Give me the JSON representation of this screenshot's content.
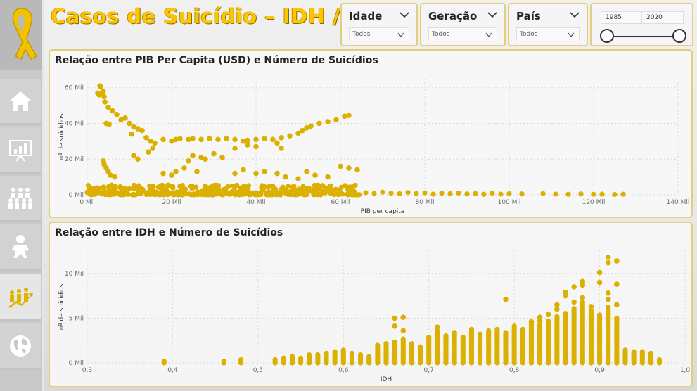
{
  "header": {
    "title": "Casos de Suicídio – IDH / PIB"
  },
  "nav": {
    "items": [
      {
        "icon": "home-icon",
        "active": false
      },
      {
        "icon": "presentation-chart-icon",
        "active": false
      },
      {
        "icon": "population-icon",
        "active": false
      },
      {
        "icon": "baby-icon",
        "active": false
      },
      {
        "icon": "growth-people-icon",
        "active": true
      },
      {
        "icon": "globe-icon",
        "active": false
      }
    ]
  },
  "filters": {
    "idade": {
      "label": "Idade",
      "value": "Todos"
    },
    "geracao": {
      "label": "Geração",
      "value": "Todos"
    },
    "pais": {
      "label": "País",
      "value": "Todos"
    },
    "ano": {
      "start": "1985",
      "end": "2020"
    }
  },
  "colors": {
    "accent": "#e0b400",
    "marker": "#dbb000"
  },
  "chart_data": [
    {
      "type": "scatter",
      "title": "Relação entre PIB Per Capita (USD) e Número de Suicídios",
      "xlabel": "PIB per capita",
      "ylabel": "nº de suicídios",
      "xlim": [
        0,
        140000
      ],
      "ylim": [
        0,
        65000
      ],
      "xticks": [
        {
          "v": 0,
          "label": "0 Mil"
        },
        {
          "v": 20000,
          "label": "20 Mil"
        },
        {
          "v": 40000,
          "label": "40 Mil"
        },
        {
          "v": 60000,
          "label": "60 Mil"
        },
        {
          "v": 80000,
          "label": "80 Mil"
        },
        {
          "v": 100000,
          "label": "100 Mil"
        },
        {
          "v": 120000,
          "label": "120 Mil"
        },
        {
          "v": 140000,
          "label": "140 Mil"
        }
      ],
      "yticks": [
        {
          "v": 0,
          "label": "0 Mil"
        },
        {
          "v": 20000,
          "label": "20 Mil"
        },
        {
          "v": 40000,
          "label": "40 Mil"
        },
        {
          "v": 60000,
          "label": "60 Mil"
        }
      ],
      "points": [
        [
          2500,
          57000
        ],
        [
          3000,
          61000
        ],
        [
          3200,
          60500
        ],
        [
          2800,
          56000
        ],
        [
          3500,
          57000
        ],
        [
          4000,
          55000
        ],
        [
          4200,
          52000
        ],
        [
          3800,
          58000
        ],
        [
          5000,
          49000
        ],
        [
          6000,
          47000
        ],
        [
          4500,
          40000
        ],
        [
          5200,
          39500
        ],
        [
          7000,
          45000
        ],
        [
          8000,
          42000
        ],
        [
          9000,
          43000
        ],
        [
          10000,
          40000
        ],
        [
          11000,
          38000
        ],
        [
          12000,
          37000
        ],
        [
          13000,
          36000
        ],
        [
          10500,
          34000
        ],
        [
          14000,
          32000
        ],
        [
          15000,
          30000
        ],
        [
          16000,
          29000
        ],
        [
          15500,
          26000
        ],
        [
          14500,
          24000
        ],
        [
          18000,
          31000
        ],
        [
          20000,
          30000
        ],
        [
          21000,
          31000
        ],
        [
          22000,
          31500
        ],
        [
          24000,
          31000
        ],
        [
          25000,
          31500
        ],
        [
          27000,
          31000
        ],
        [
          29000,
          31500
        ],
        [
          31000,
          31000
        ],
        [
          33000,
          31500
        ],
        [
          35000,
          31000
        ],
        [
          37000,
          30000
        ],
        [
          38000,
          30500
        ],
        [
          40000,
          31000
        ],
        [
          42000,
          31500
        ],
        [
          44000,
          31000
        ],
        [
          46000,
          32000
        ],
        [
          48000,
          33000
        ],
        [
          50000,
          34500
        ],
        [
          51000,
          36000
        ],
        [
          52000,
          37500
        ],
        [
          53000,
          38500
        ],
        [
          55000,
          40000
        ],
        [
          57000,
          41000
        ],
        [
          59000,
          42000
        ],
        [
          61000,
          44000
        ],
        [
          62000,
          44500
        ],
        [
          45000,
          29000
        ],
        [
          46000,
          26000
        ],
        [
          38000,
          28000
        ],
        [
          35000,
          26000
        ],
        [
          40000,
          27000
        ],
        [
          30000,
          23000
        ],
        [
          28000,
          20000
        ],
        [
          27000,
          21000
        ],
        [
          25000,
          22000
        ],
        [
          32000,
          21000
        ],
        [
          24000,
          19000
        ],
        [
          23000,
          15000
        ],
        [
          26000,
          13000
        ],
        [
          35000,
          12000
        ],
        [
          37000,
          14000
        ],
        [
          40000,
          12000
        ],
        [
          42000,
          13000
        ],
        [
          45000,
          12000
        ],
        [
          47000,
          10000
        ],
        [
          50000,
          9000
        ],
        [
          52000,
          13000
        ],
        [
          54000,
          11000
        ],
        [
          57000,
          10000
        ],
        [
          60000,
          16000
        ],
        [
          62000,
          15000
        ],
        [
          64000,
          14000
        ],
        [
          11000,
          22000
        ],
        [
          12000,
          20000
        ],
        [
          18000,
          12000
        ],
        [
          20000,
          11000
        ],
        [
          21000,
          13000
        ],
        [
          4000,
          17000
        ],
        [
          4500,
          15000
        ],
        [
          5000,
          13000
        ],
        [
          3800,
          19000
        ],
        [
          5500,
          11000
        ],
        [
          6500,
          10000
        ]
      ],
      "dense_band": {
        "x_from": 0,
        "x_to": 65000,
        "y_from": 0,
        "y_to": 5500
      },
      "low_band_points": [
        [
          66000,
          1200
        ],
        [
          68000,
          800
        ],
        [
          70000,
          1500
        ],
        [
          72000,
          900
        ],
        [
          74000,
          600
        ],
        [
          76000,
          1300
        ],
        [
          78000,
          700
        ],
        [
          80000,
          1100
        ],
        [
          82000,
          400
        ],
        [
          84000,
          900
        ],
        [
          86000,
          600
        ],
        [
          88000,
          1000
        ],
        [
          90000,
          500
        ],
        [
          92000,
          700
        ],
        [
          94000,
          300
        ],
        [
          96000,
          900
        ],
        [
          98000,
          400
        ],
        [
          100000,
          600
        ],
        [
          103000,
          500
        ],
        [
          108000,
          700
        ],
        [
          111000,
          400
        ],
        [
          114000,
          300
        ],
        [
          117000,
          500
        ],
        [
          120000,
          300
        ],
        [
          122000,
          400
        ],
        [
          125000,
          200
        ],
        [
          127000,
          300
        ]
      ]
    },
    {
      "type": "scatter",
      "title": "Relação entre IDH e Número de Suicídios",
      "xlabel": "IDH",
      "ylabel": "nº de suicídios",
      "xlim": [
        0.3,
        1.0
      ],
      "ylim": [
        0,
        12500
      ],
      "xticks": [
        {
          "v": 0.3,
          "label": "0,3"
        },
        {
          "v": 0.4,
          "label": "0,4"
        },
        {
          "v": 0.5,
          "label": "0,5"
        },
        {
          "v": 0.6,
          "label": "0,6"
        },
        {
          "v": 0.7,
          "label": "0,7"
        },
        {
          "v": 0.8,
          "label": "0,8"
        },
        {
          "v": 0.9,
          "label": "0,9"
        },
        {
          "v": 1.0,
          "label": "1,0"
        }
      ],
      "yticks": [
        {
          "v": 0,
          "label": "0 Mil"
        },
        {
          "v": 5000,
          "label": "5 Mil"
        },
        {
          "v": 10000,
          "label": "10 Mil"
        }
      ],
      "columns": [
        [
          0.39,
          300
        ],
        [
          0.46,
          300
        ],
        [
          0.48,
          400
        ],
        [
          0.52,
          500
        ],
        [
          0.53,
          600
        ],
        [
          0.54,
          800
        ],
        [
          0.55,
          700
        ],
        [
          0.56,
          900
        ],
        [
          0.57,
          1000
        ],
        [
          0.58,
          1200
        ],
        [
          0.59,
          1300
        ],
        [
          0.6,
          1500
        ],
        [
          0.61,
          1100
        ],
        [
          0.62,
          900
        ],
        [
          0.63,
          800
        ],
        [
          0.64,
          2000
        ],
        [
          0.65,
          2200
        ],
        [
          0.66,
          2500
        ],
        [
          0.67,
          2800
        ],
        [
          0.68,
          2300
        ],
        [
          0.69,
          1900
        ],
        [
          0.7,
          3000
        ],
        [
          0.71,
          3600
        ],
        [
          0.72,
          3200
        ],
        [
          0.73,
          3400
        ],
        [
          0.74,
          3000
        ],
        [
          0.75,
          3800
        ],
        [
          0.76,
          3300
        ],
        [
          0.77,
          3700
        ],
        [
          0.78,
          3900
        ],
        [
          0.79,
          3500
        ],
        [
          0.8,
          4200
        ],
        [
          0.81,
          3800
        ],
        [
          0.82,
          4500
        ],
        [
          0.83,
          4300
        ],
        [
          0.84,
          4800
        ],
        [
          0.85,
          5200
        ],
        [
          0.86,
          5600
        ],
        [
          0.87,
          6200
        ],
        [
          0.88,
          6800
        ],
        [
          0.89,
          6000
        ],
        [
          0.9,
          5400
        ],
        [
          0.91,
          6400
        ],
        [
          0.92,
          5000
        ],
        [
          0.93,
          1500
        ],
        [
          0.94,
          1400
        ],
        [
          0.95,
          1300
        ],
        [
          0.96,
          1200
        ],
        [
          0.97,
          500
        ]
      ],
      "points": [
        [
          0.66,
          5000
        ],
        [
          0.67,
          5100
        ],
        [
          0.66,
          4100
        ],
        [
          0.67,
          3600
        ],
        [
          0.71,
          4000
        ],
        [
          0.79,
          7100
        ],
        [
          0.86,
          7500
        ],
        [
          0.86,
          7900
        ],
        [
          0.87,
          8500
        ],
        [
          0.88,
          8700
        ],
        [
          0.88,
          9100
        ],
        [
          0.9,
          9000
        ],
        [
          0.9,
          10100
        ],
        [
          0.91,
          11800
        ],
        [
          0.92,
          11400
        ],
        [
          0.91,
          11200
        ],
        [
          0.92,
          8800
        ],
        [
          0.91,
          7800
        ],
        [
          0.91,
          7100
        ],
        [
          0.92,
          6500
        ],
        [
          0.89,
          6300
        ],
        [
          0.85,
          6500
        ],
        [
          0.85,
          6000
        ],
        [
          0.86,
          5200
        ],
        [
          0.84,
          5400
        ],
        [
          0.83,
          5100
        ],
        [
          0.83,
          4700
        ],
        [
          0.82,
          4600
        ],
        [
          0.87,
          6800
        ],
        [
          0.88,
          7300
        ]
      ]
    }
  ]
}
